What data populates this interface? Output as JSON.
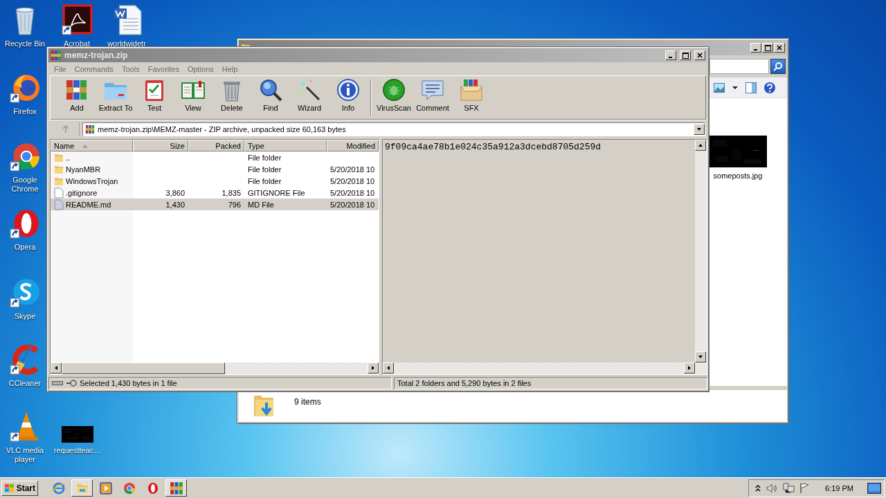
{
  "desktop_icons": [
    {
      "kind": "recycle-bin",
      "label": "Recycle Bin"
    },
    {
      "kind": "pdf",
      "label": "Acrobat"
    },
    {
      "kind": "word",
      "label": "worldwidetr"
    },
    {
      "kind": "firefox",
      "label": "Firefox"
    },
    {
      "kind": "chrome",
      "label": "Google Chrome"
    },
    {
      "kind": "opera",
      "label": "Opera"
    },
    {
      "kind": "skype",
      "label": "Skype"
    },
    {
      "kind": "ccleaner",
      "label": "CCleaner"
    },
    {
      "kind": "vlc",
      "label": "VLC media player"
    },
    {
      "kind": "thumbnail",
      "label": "requestteac…"
    }
  ],
  "explorer": {
    "file": {
      "name": "someposts.jpg"
    },
    "details": {
      "count": "9 items"
    }
  },
  "archive": {
    "title": "memz-trojan.zip",
    "menu": [
      "File",
      "Commands",
      "Tools",
      "Favorites",
      "Options",
      "Help"
    ],
    "toolbar_groups": [
      {
        "buttons": [
          {
            "kind": "add",
            "label": "Add"
          },
          {
            "kind": "extract",
            "label": "Extract To"
          },
          {
            "kind": "test",
            "label": "Test"
          },
          {
            "kind": "view",
            "label": "View"
          },
          {
            "kind": "delete",
            "label": "Delete"
          },
          {
            "kind": "find",
            "label": "Find"
          },
          {
            "kind": "wizard",
            "label": "Wizard"
          },
          {
            "kind": "info",
            "label": "Info"
          }
        ]
      },
      {
        "buttons": [
          {
            "kind": "virusscan",
            "label": "VirusScan"
          },
          {
            "kind": "comment",
            "label": "Comment"
          },
          {
            "kind": "sfx",
            "label": "SFX"
          }
        ]
      }
    ],
    "path": "memz-trojan.zip\\MEMZ-master - ZIP archive, unpacked size 60,163 bytes",
    "columns": [
      "Name",
      "Size",
      "Packed",
      "Type",
      "Modified"
    ],
    "rows": [
      {
        "kind": "folder",
        "name": "..",
        "size": "",
        "packed": "",
        "type": "File folder",
        "modified": "",
        "selected": false
      },
      {
        "kind": "folder",
        "name": "NyanMBR",
        "size": "",
        "packed": "",
        "type": "File folder",
        "modified": "5/20/2018 10",
        "selected": false
      },
      {
        "kind": "folder",
        "name": "WindowsTrojan",
        "size": "",
        "packed": "",
        "type": "File folder",
        "modified": "5/20/2018 10",
        "selected": false
      },
      {
        "kind": "file",
        "name": ".gitignore",
        "size": "3,860",
        "packed": "1,835",
        "type": "GITIGNORE File",
        "modified": "5/20/2018 10",
        "selected": false
      },
      {
        "kind": "file",
        "name": "README.md",
        "size": "1,430",
        "packed": "796",
        "type": "MD File",
        "modified": "5/20/2018 10",
        "selected": true
      }
    ],
    "preview": "9f09ca4ae78b1e024c35a912a3dcebd8705d259d",
    "status_left": "Selected 1,430 bytes in 1 file",
    "status_right": "Total 2 folders and 5,290 bytes in 2 files"
  },
  "taskbar": {
    "start": "Start",
    "apps": [
      {
        "kind": "ie",
        "pressed": false
      },
      {
        "kind": "explorer",
        "pressed": true
      },
      {
        "kind": "media",
        "pressed": false
      },
      {
        "kind": "chrome",
        "pressed": false
      },
      {
        "kind": "opera",
        "pressed": false
      },
      {
        "kind": "winrar",
        "pressed": true
      }
    ],
    "clock": "6:19 PM"
  }
}
